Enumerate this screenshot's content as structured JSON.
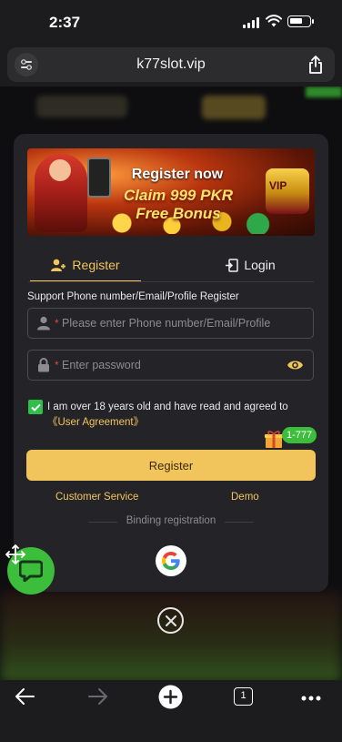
{
  "status": {
    "time": "2:37"
  },
  "browser": {
    "host": "k77slot.vip",
    "tab_count": "1"
  },
  "banner": {
    "line1": "Register now",
    "line2": "Claim 999 PKR Free Bonus",
    "badge": "VIP"
  },
  "tabs": {
    "register": "Register",
    "login": "Login"
  },
  "form": {
    "support_text": "Support Phone number/Email/Profile Register",
    "required_mark": "*",
    "phone_placeholder": "Please enter Phone number/Email/Profile",
    "password_placeholder": "Enter password",
    "agree_text": "I am over 18 years old and have read and agreed to",
    "agreement_link": "《User Agreement》",
    "agree_checked": true,
    "register_button": "Register",
    "gift_tag": "1-777"
  },
  "links": {
    "customer_service": "Customer Service",
    "demo": "Demo",
    "binding": "Binding registration"
  },
  "colors": {
    "accent": "#f2c55c",
    "green": "#3cbd3c",
    "error": "#e0443a",
    "modal_bg": "#242428"
  }
}
